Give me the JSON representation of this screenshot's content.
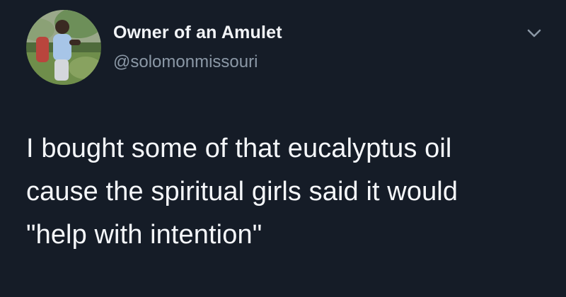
{
  "colors": {
    "background": "#151c27",
    "name": "#f2f4f7",
    "handle": "#8b98a6",
    "text": "#f5f7fa"
  },
  "tweet": {
    "author_name": "Owner of an Amulet",
    "author_handle": "@solomonmissouri",
    "avatar_icon": "profile-photo",
    "menu_icon": "chevron-down-icon",
    "text": "I bought some of that eucalyptus oil\ncause the spiritual girls said it would\n\"help with intention\""
  }
}
